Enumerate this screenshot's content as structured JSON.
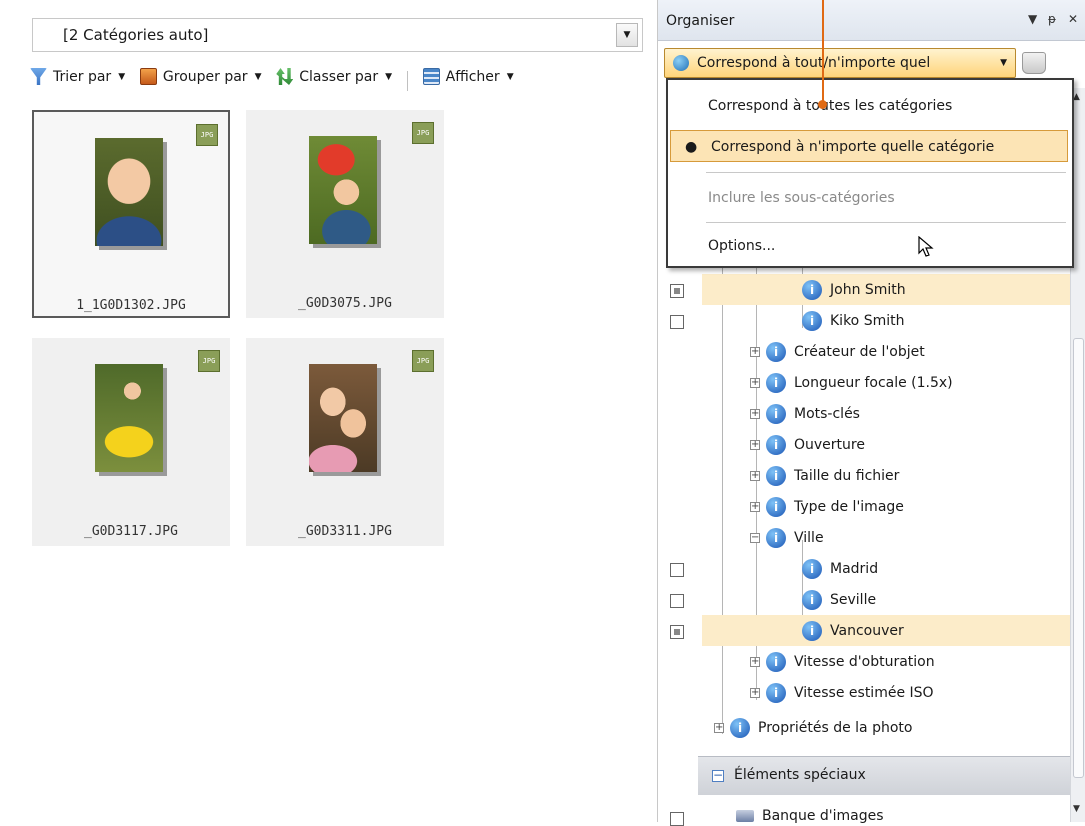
{
  "browser": {
    "category_combo": "[2 Catégories auto]",
    "toolbar": {
      "sort": "Trier par",
      "group": "Grouper par",
      "order": "Classer par",
      "view": "Afficher"
    },
    "thumbnails": [
      {
        "name": "1_1G0D1302.JPG",
        "badge": "JPG",
        "selected": true
      },
      {
        "name": "_G0D3075.JPG",
        "badge": "JPG",
        "selected": false
      },
      {
        "name": "_G0D3117.JPG",
        "badge": "JPG",
        "selected": false
      },
      {
        "name": "_G0D3311.JPG",
        "badge": "JPG",
        "selected": false
      }
    ]
  },
  "organiser": {
    "title": "Organiser",
    "match_button": "Correspond à tout/n'importe quel",
    "menu": {
      "all": "Correspond à toutes les catégories",
      "any": "Correspond à n'importe quelle catégorie",
      "include_sub": "Inclure les sous-catégories",
      "options": "Options..."
    },
    "tree": {
      "john": "John Smith",
      "kiko": "Kiko Smith",
      "createur": "Créateur de l'objet",
      "focale": "Longueur focale (1.5x)",
      "mots": "Mots-clés",
      "ouverture": "Ouverture",
      "taille": "Taille du fichier",
      "type": "Type de l'image",
      "ville": "Ville",
      "madrid": "Madrid",
      "seville": "Seville",
      "vancouver": "Vancouver",
      "vitesse_obt": "Vitesse d'obturation",
      "vitesse_iso": "Vitesse estimée ISO",
      "proprietes": "Propriétés de la photo"
    },
    "special_header": "Éléments spéciaux",
    "banque": "Banque d'images"
  },
  "colors": {
    "accent_orange": "#e06a14",
    "highlight": "#fce4b5",
    "tree_selected": "#fcecc9"
  }
}
